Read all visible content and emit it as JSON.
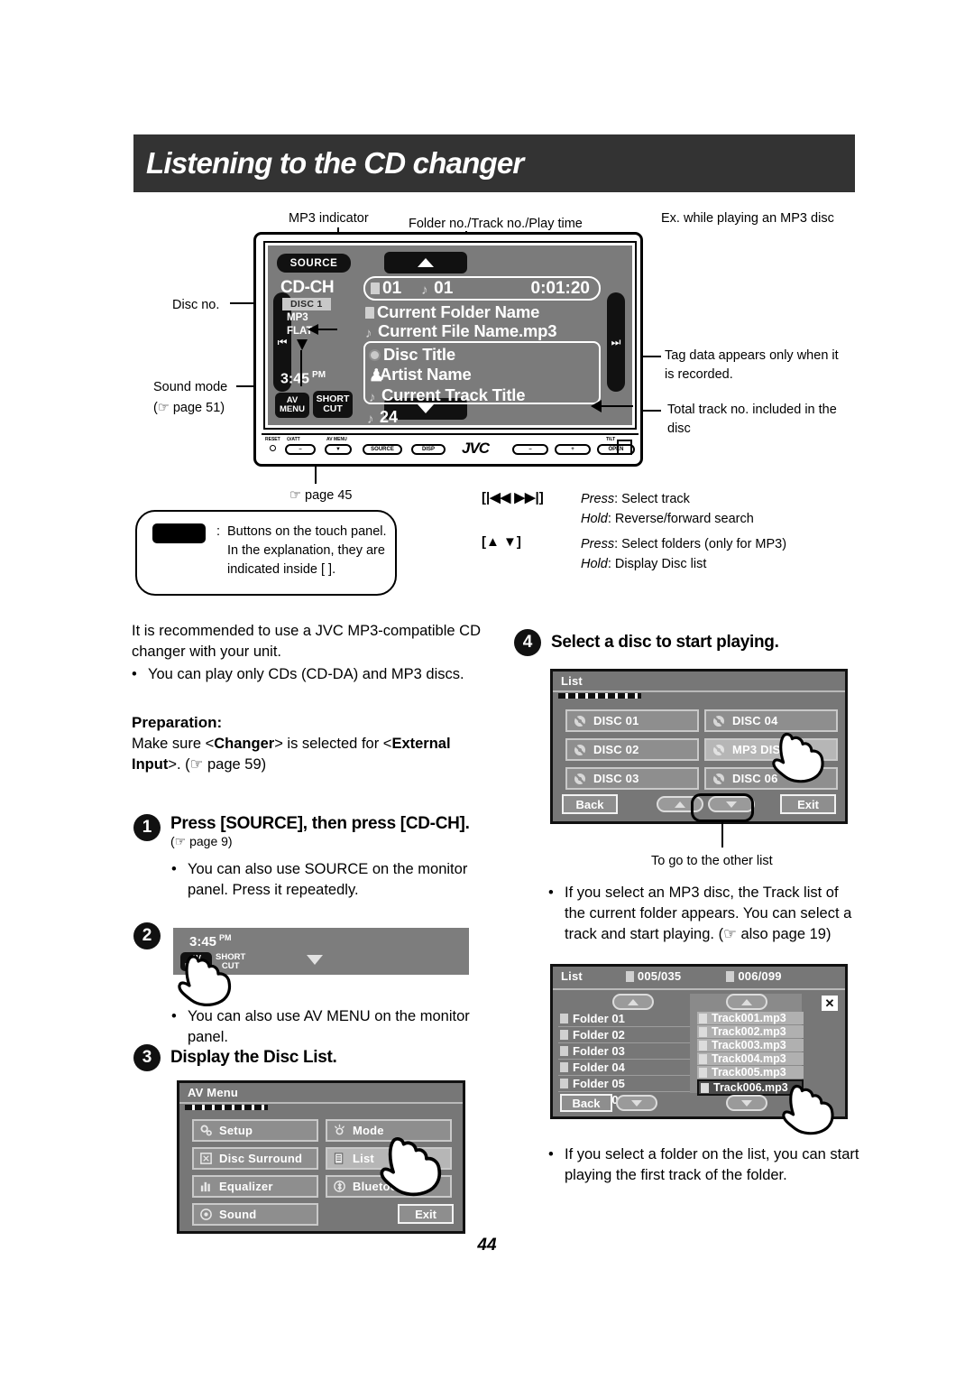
{
  "header": {
    "title": "Listening to the CD changer"
  },
  "diagram": {
    "callouts": {
      "mp3_indicator": "MP3 indicator",
      "folder_track_time": "Folder no./Track no./Play time",
      "example": "Ex. while playing an MP3 disc",
      "disc_no": "Disc no.",
      "sound_mode": "Sound mode",
      "sound_mode_ref": "(☞ page 51)",
      "page45_ref": "☞ page 45",
      "tag_data": "Tag data appears only when it is recorded.",
      "total_track": "Total track no. included in the disc"
    },
    "unit": {
      "source_button": "SOURCE",
      "source_name": "CD-CH",
      "disc_no": "DISC 1",
      "mp3_indicator": "MP3",
      "sound_mode": "FLAT",
      "clock_time": "3:45",
      "clock_meridiem": "PM",
      "av_menu_line1": "AV",
      "av_menu_line2": "MENU",
      "shortcut_line1": "SHORT",
      "shortcut_line2": "CUT",
      "folder_no": "01",
      "track_no": "01",
      "play_time": "0:01:20",
      "folder_name": "Current Folder Name",
      "file_name": "Current File Name.mp3",
      "disc_title": "Disc Title",
      "artist_name": "Artist Name",
      "track_title": "Current Track Title",
      "total_tracks": "24",
      "prev_icon": "⏮",
      "next_icon": "⏭",
      "panel_keys": {
        "reset": "RESET",
        "power_att": "⏻/ATT",
        "av_menu": "AV MENU",
        "source": "SOURCE",
        "disp": "DISP",
        "brand": "JVC",
        "minus": "–",
        "plus": "+",
        "tilt": "TILT",
        "open": "OPEN"
      }
    },
    "legend": {
      "colon": ":",
      "text": "Buttons on the touch panel. In the explanation, they are indicated inside [    ]."
    },
    "key_help": [
      {
        "keys": "[|◀◀  ▶▶|]",
        "press_label": "Press",
        "press_text": ": Select track",
        "hold_label": "Hold",
        "hold_text": ": Reverse/forward search"
      },
      {
        "keys": "[▲ ▼]",
        "press_label": "Press",
        "press_text": ": Select folders (only for MP3)",
        "hold_label": "Hold",
        "hold_text": ": Display Disc list"
      }
    ]
  },
  "left_column": {
    "intro": "It is recommended to use a JVC MP3-compatible CD changer with your unit.",
    "intro_bullet": "You can play only CDs (CD-DA) and MP3 discs.",
    "preparation_heading": "Preparation:",
    "preparation_text_1": "Make sure <",
    "preparation_changer": "Changer",
    "preparation_text_2": "> is selected for <",
    "preparation_external": "External Input",
    "preparation_text_3": ">. (☞ page 59)",
    "step1": {
      "number": "1",
      "title": "Press [SOURCE], then press [CD-CH].",
      "ref": "(☞ page 9)",
      "bullet": "You can also use SOURCE on the monitor panel. Press it repeatedly."
    },
    "step2": {
      "number": "2",
      "clock_time": "3:45",
      "clock_meridiem": "PM",
      "av_menu_line1": "AV",
      "av_menu_line2": "MENU",
      "shortcut_line1": "SHORT",
      "shortcut_line2": "CUT",
      "bullet": "You can also use AV MENU on the monitor panel."
    },
    "step3": {
      "number": "3",
      "title": "Display the Disc List.",
      "menu": {
        "title": "AV Menu",
        "items": [
          {
            "label": "Setup",
            "icon": "gears-icon",
            "selected": false
          },
          {
            "label": "Mode",
            "icon": "sun-icon",
            "selected": false
          },
          {
            "label": "Disc Surround",
            "icon": "surround-icon",
            "selected": false
          },
          {
            "label": "List",
            "icon": "list-icon",
            "selected": true
          },
          {
            "label": "Equalizer",
            "icon": "equalizer-icon",
            "selected": false
          },
          {
            "label": "Bluetooth",
            "icon": "bluetooth-icon",
            "selected": false
          },
          {
            "label": "Sound",
            "icon": "sound-icon",
            "selected": false
          }
        ],
        "exit": "Exit"
      }
    }
  },
  "right_column": {
    "step4": {
      "number": "4",
      "title": "Select a disc to start playing.",
      "disc_list": {
        "title": "List",
        "discs": [
          {
            "label": "DISC 01",
            "selected": false
          },
          {
            "label": "DISC 04",
            "selected": false
          },
          {
            "label": "DISC 02",
            "selected": false
          },
          {
            "label": "MP3 DISC",
            "selected": true
          },
          {
            "label": "DISC 03",
            "selected": false
          },
          {
            "label": "DISC 06",
            "selected": false
          }
        ],
        "back": "Back",
        "exit": "Exit"
      },
      "other_list_caption": "To go to the other list",
      "bullet_mp3": "If you select an MP3 disc, the Track list of the current folder appears. You can select a track and start playing. (☞ also page 19)",
      "bullet_folder": "If you select a folder on the list, you can start playing the first track of the folder."
    },
    "folder_track_panel": {
      "title": "List",
      "folder_counter": "005/035",
      "track_counter": "006/099",
      "folders": [
        "Folder 01",
        "Folder 02",
        "Folder 03",
        "Folder 04",
        "Folder 05",
        "Folder 06"
      ],
      "tracks": [
        "Track001.mp3",
        "Track002.mp3",
        "Track003.mp3",
        "Track004.mp3",
        "Track005.mp3",
        "Track006.mp3"
      ],
      "selected_track": "Track006.mp3",
      "back": "Back",
      "close_icon": "✕"
    }
  },
  "footer": {
    "page_number": "44"
  },
  "colors": {
    "banner": "#333333",
    "screen_bg": "#7b7b7b",
    "panel_bg": "#777777",
    "button_bg": "#8e8e8e",
    "button_selected": "#b6b6b6",
    "button_border": "#c9c9c9"
  }
}
